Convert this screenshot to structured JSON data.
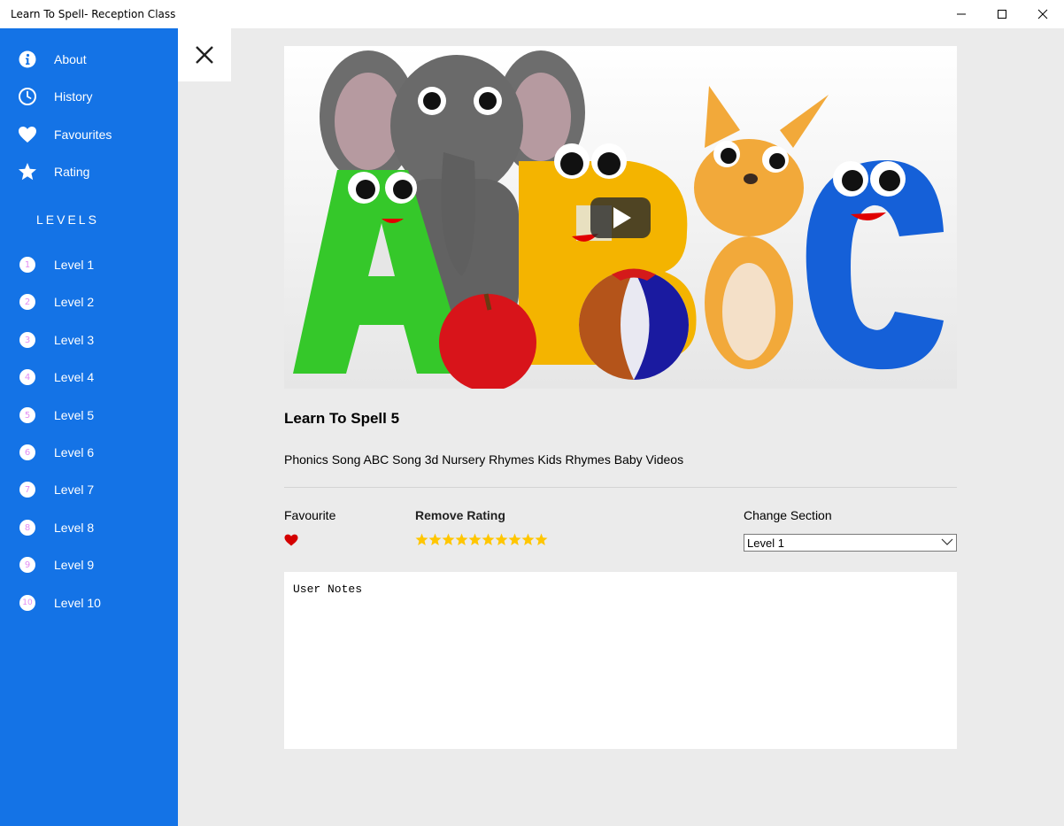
{
  "window": {
    "title": "Learn To Spell- Reception Class"
  },
  "sidebar": {
    "items": [
      {
        "label": "About",
        "icon": "info-icon"
      },
      {
        "label": "History",
        "icon": "clock-icon"
      },
      {
        "label": "Favourites",
        "icon": "heart-icon"
      },
      {
        "label": "Rating",
        "icon": "star-icon"
      }
    ],
    "levels_heading": "LEVELS",
    "levels": [
      {
        "num": "1",
        "label": "Level 1"
      },
      {
        "num": "2",
        "label": "Level 2"
      },
      {
        "num": "3",
        "label": "Level 3"
      },
      {
        "num": "4",
        "label": "Level 4"
      },
      {
        "num": "5",
        "label": "Level 5"
      },
      {
        "num": "6",
        "label": "Level 6"
      },
      {
        "num": "7",
        "label": "Level 7"
      },
      {
        "num": "8",
        "label": "Level 8"
      },
      {
        "num": "9",
        "label": "Level 9"
      },
      {
        "num": "10",
        "label": "Level 10"
      }
    ]
  },
  "video": {
    "title": "Learn To Spell 5",
    "description": "Phonics Song ABC Song 3d Nursery Rhymes Kids Rhymes Baby Videos"
  },
  "favourite": {
    "label": "Favourite",
    "is_favourite": true
  },
  "rating": {
    "label": "Remove Rating",
    "stars": 10,
    "max": 10
  },
  "change_section": {
    "label": "Change Section",
    "selected": "Level 1"
  },
  "notes": {
    "placeholder": "User Notes"
  },
  "colors": {
    "sidebar": "#1473e6",
    "accent_star": "#ffc600",
    "heart": "#d40000",
    "level_number": "#e28ef3"
  }
}
